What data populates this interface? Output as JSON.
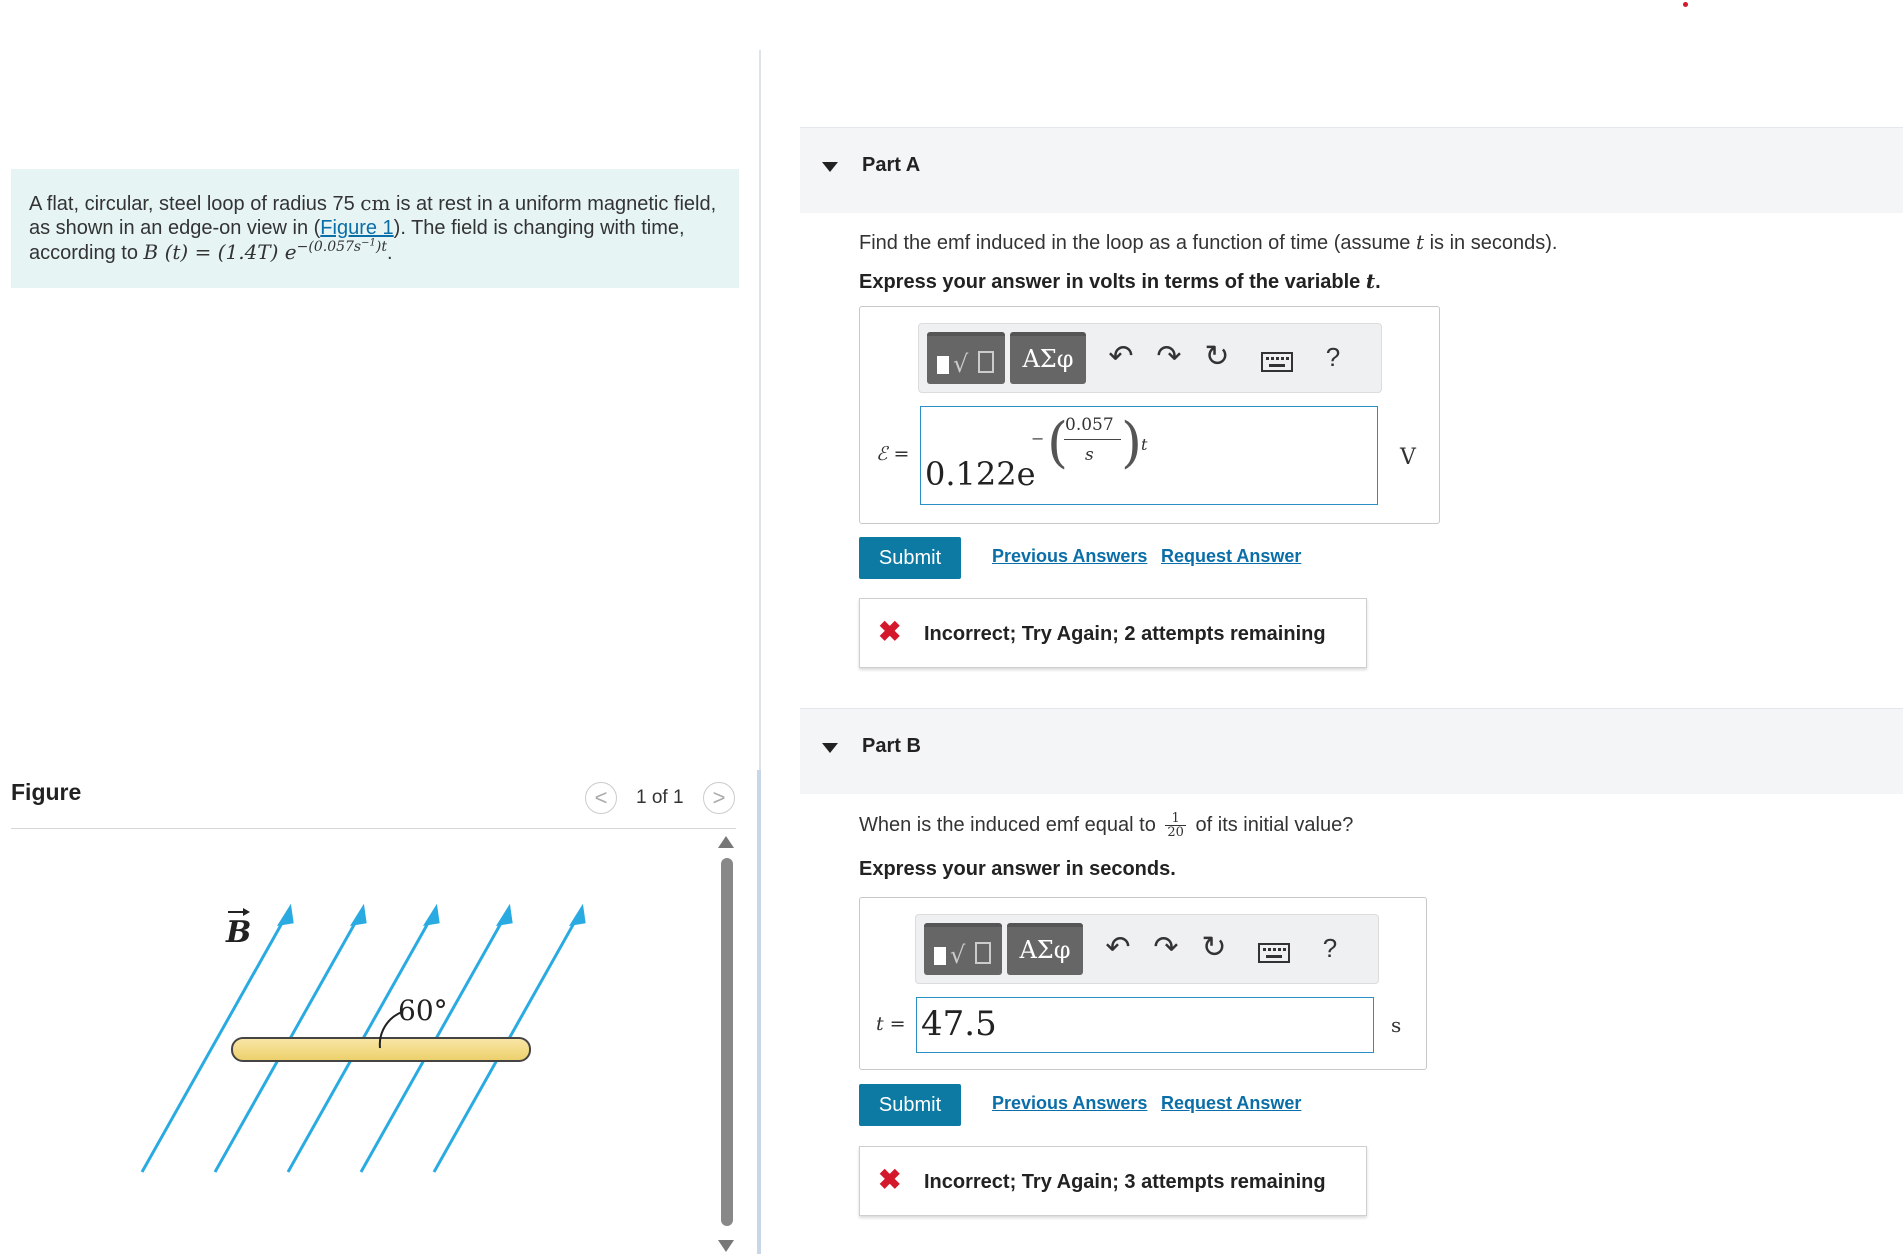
{
  "problem": {
    "text_1": "A flat, circular, steel loop of radius 75 ",
    "unit_cm": "cm",
    "text_2": " is at rest in a uniform magnetic field, as shown in an edge-on view in (",
    "figure_link": "Figure 1",
    "text_3": "). The field is changing with time, according to ",
    "formula_lhs": "B (t) = (1.4T) e",
    "formula_exp": "−(0.057s",
    "formula_exp_sup": "−1",
    "formula_exp_end": ")t",
    "period": "."
  },
  "figure": {
    "title": "Figure",
    "nav_prev": "<",
    "nav_next": ">",
    "count": "1 of 1",
    "field_label": "B",
    "angle_label": "60°"
  },
  "colors": {
    "field_lines": "#29abe2",
    "loop_fill": "#f6dc86",
    "submit": "#0d7aa3",
    "link": "#0a6ea8",
    "error": "#d3192b",
    "problem_bg": "#e6f4f4"
  },
  "partA": {
    "label": "Part A",
    "question_1": "Find the emf induced in the loop as a function of time (assume ",
    "question_var": "t",
    "question_2": " is in seconds).",
    "instruct_1": "Express your answer in volts in terms of the variable ",
    "instruct_var": "t",
    "instruct_2": ".",
    "toolbar": {
      "templates_icon": "templates-icon",
      "greek": "ΑΣφ",
      "undo": "↶",
      "redo": "↷",
      "reset": "↻",
      "keyboard": "keyboard-icon",
      "help": "?"
    },
    "eq_label": "ℰ =",
    "answer_coeff": "0.122e",
    "answer_exp_minus": "−",
    "answer_exp_num": "0.057",
    "answer_exp_den": "s",
    "answer_exp_t": "t",
    "unit": "V",
    "submit": "Submit",
    "previous_answers": "Previous Answers",
    "request_answer": "Request Answer",
    "feedback_icon": "✖",
    "feedback": "Incorrect; Try Again; 2 attempts remaining"
  },
  "partB": {
    "label": "Part B",
    "question_1": "When is the induced emf equal to ",
    "frac_num": "1",
    "frac_den": "20",
    "question_2": " of its initial value?",
    "instruct": "Express your answer in seconds.",
    "toolbar": {
      "templates_icon": "templates-icon",
      "greek": "ΑΣφ",
      "undo": "↶",
      "redo": "↷",
      "reset": "↻",
      "keyboard": "keyboard-icon",
      "help": "?"
    },
    "eq_label": "t =",
    "answer": "47.5",
    "unit": "s",
    "submit": "Submit",
    "previous_answers": "Previous Answers",
    "request_answer": "Request Answer",
    "feedback_icon": "✖",
    "feedback": "Incorrect; Try Again; 3 attempts remaining"
  }
}
